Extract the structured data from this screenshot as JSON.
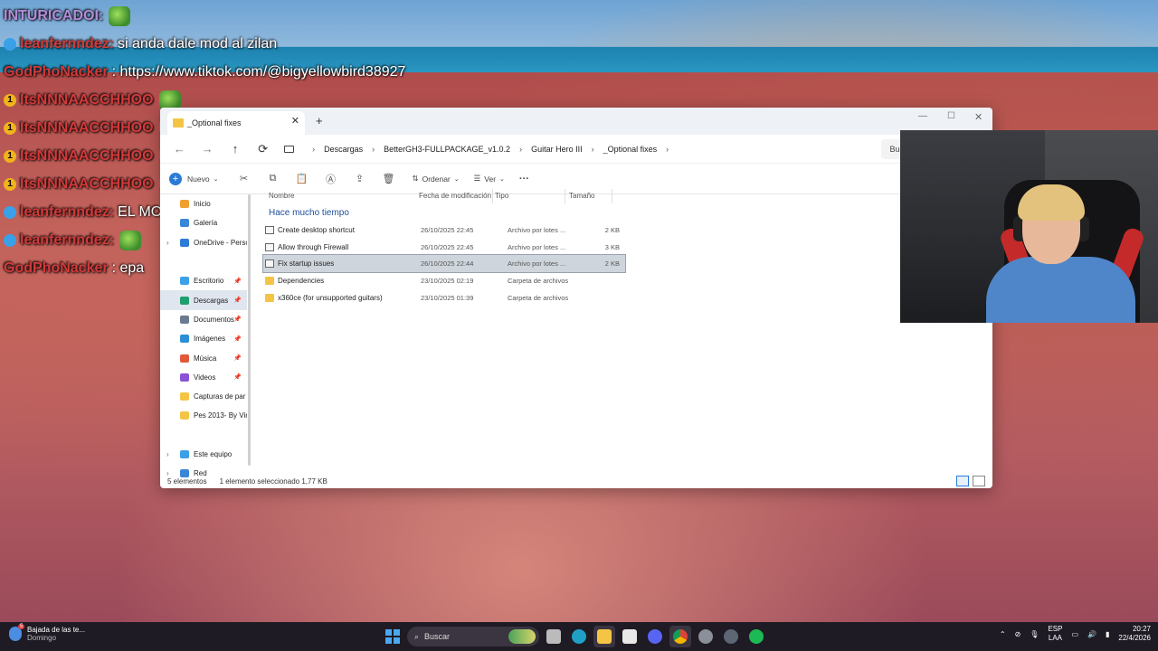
{
  "chat": [
    {
      "user": "INTURICADOI:",
      "message": "",
      "badge": "none",
      "user_color": "#b38cd9",
      "emote": true
    },
    {
      "user": "leanfernndez:",
      "message": "si anda dale mod al zilan",
      "badge": "blue",
      "user_color": "#d23a3a"
    },
    {
      "user": "GodPhoNacker",
      "message": ": https://www.tiktok.com/@bigyellowbird38927",
      "badge": "none",
      "user_color": "#d23a3a"
    },
    {
      "user": "ItsNNNAACCHHOO",
      "message": "",
      "badge": "gold",
      "user_color": "#d23a3a",
      "emote": true
    },
    {
      "user": "ItsNNNAACCHHOO",
      "message": "",
      "badge": "gold",
      "user_color": "#d23a3a",
      "emote": true
    },
    {
      "user": "ItsNNNAACCHHOO",
      "message": "",
      "badge": "gold",
      "user_color": "#d23a3a",
      "emote": true
    },
    {
      "user": "ItsNNNAACCHHOO",
      "message": "",
      "badge": "gold",
      "user_color": "#d23a3a",
      "emote": true
    },
    {
      "user": "leanfernndez:",
      "message": "EL MOGOLICO DE DELRU RE LARGA",
      "badge": "blue",
      "user_color": "#d23a3a"
    },
    {
      "user": "leanfernndez:",
      "message": "",
      "badge": "blue",
      "user_color": "#d23a3a",
      "emote": true
    },
    {
      "user": "GodPhoNacker",
      "message": ": epa",
      "badge": "none",
      "user_color": "#d23a3a"
    }
  ],
  "explorer": {
    "tab_title": "_Optional fixes",
    "new_tab": "+",
    "nav": {
      "back": "←",
      "forward": "→",
      "up": "↑",
      "refresh": "⟳"
    },
    "breadcrumb": [
      "Descargas",
      "BetterGH3-FULLPACKAGE_v1.0.2",
      "Guitar Hero III",
      "_Optional fixes"
    ],
    "search_placeholder": "Buscar en _Optional fixes",
    "toolbar": {
      "new": "Nuevo",
      "sort": "Ordenar",
      "view": "Ver",
      "more": "···"
    },
    "sidebar": [
      {
        "label": "Inicio",
        "icon": "home-icon",
        "pin": false,
        "chev": false
      },
      {
        "label": "Galería",
        "icon": "gallery-icon",
        "pin": false,
        "chev": false
      },
      {
        "label": "OneDrive - Perso",
        "icon": "onedrive-icon",
        "pin": false,
        "chev": true
      },
      {
        "label": "",
        "icon": "",
        "pin": false,
        "chev": false
      },
      {
        "label": "Escritorio",
        "icon": "desktop-icon",
        "pin": true,
        "chev": false
      },
      {
        "label": "Descargas",
        "icon": "downloads-icon",
        "pin": true,
        "chev": false,
        "selected": true
      },
      {
        "label": "Documentos",
        "icon": "documents-icon",
        "pin": true,
        "chev": false
      },
      {
        "label": "Imágenes",
        "icon": "pictures-icon",
        "pin": true,
        "chev": false
      },
      {
        "label": "Música",
        "icon": "music-icon",
        "pin": true,
        "chev": false
      },
      {
        "label": "Videos",
        "icon": "videos-icon",
        "pin": true,
        "chev": false
      },
      {
        "label": "Capturas de par",
        "icon": "folder-icon",
        "pin": false,
        "chev": false
      },
      {
        "label": "Pes 2013- By Vir",
        "icon": "folder-icon",
        "pin": false,
        "chev": false
      },
      {
        "label": "",
        "icon": "",
        "pin": false,
        "chev": false
      },
      {
        "label": "Este equipo",
        "icon": "pc-icon",
        "pin": false,
        "chev": true
      },
      {
        "label": "Red",
        "icon": "network-icon",
        "pin": false,
        "chev": true
      }
    ],
    "columns": [
      "Nombre",
      "Fecha de modificación",
      "Tipo",
      "Tamaño"
    ],
    "group_label": "Hace mucho tiempo",
    "files": [
      {
        "name": "Create desktop shortcut",
        "date": "26/10/2025 22:45",
        "type": "Archivo por lotes ...",
        "size": "2 KB",
        "kind": "bat"
      },
      {
        "name": "Allow through Firewall",
        "date": "26/10/2025 22:45",
        "type": "Archivo por lotes ...",
        "size": "3 KB",
        "kind": "bat"
      },
      {
        "name": "Fix startup issues",
        "date": "26/10/2025 22:44",
        "type": "Archivo por lotes ...",
        "size": "2 KB",
        "kind": "bat",
        "selected": true
      },
      {
        "name": "Dependencies",
        "date": "23/10/2025 02:19",
        "type": "Carpeta de archivos",
        "size": "",
        "kind": "folder"
      },
      {
        "name": "x360ce (for unsupported guitars)",
        "date": "23/10/2025 01:39",
        "type": "Carpeta de archivos",
        "size": "",
        "kind": "folder"
      }
    ],
    "status": {
      "count": "5 elementos",
      "selection": "1 elemento seleccionado  1,77 KB"
    }
  },
  "taskbar": {
    "weather_title": "Bajada de las te...",
    "weather_sub": "Domingo",
    "weather_badge": "5",
    "search_label": "Buscar",
    "lang_top": "ESP",
    "lang_bottom": "LAA",
    "time": "20:27",
    "date": "22/4/2026"
  },
  "colors": {
    "accent": "#2b7bd6",
    "folder": "#f4c545",
    "selected_row": "#cfd5dc"
  }
}
